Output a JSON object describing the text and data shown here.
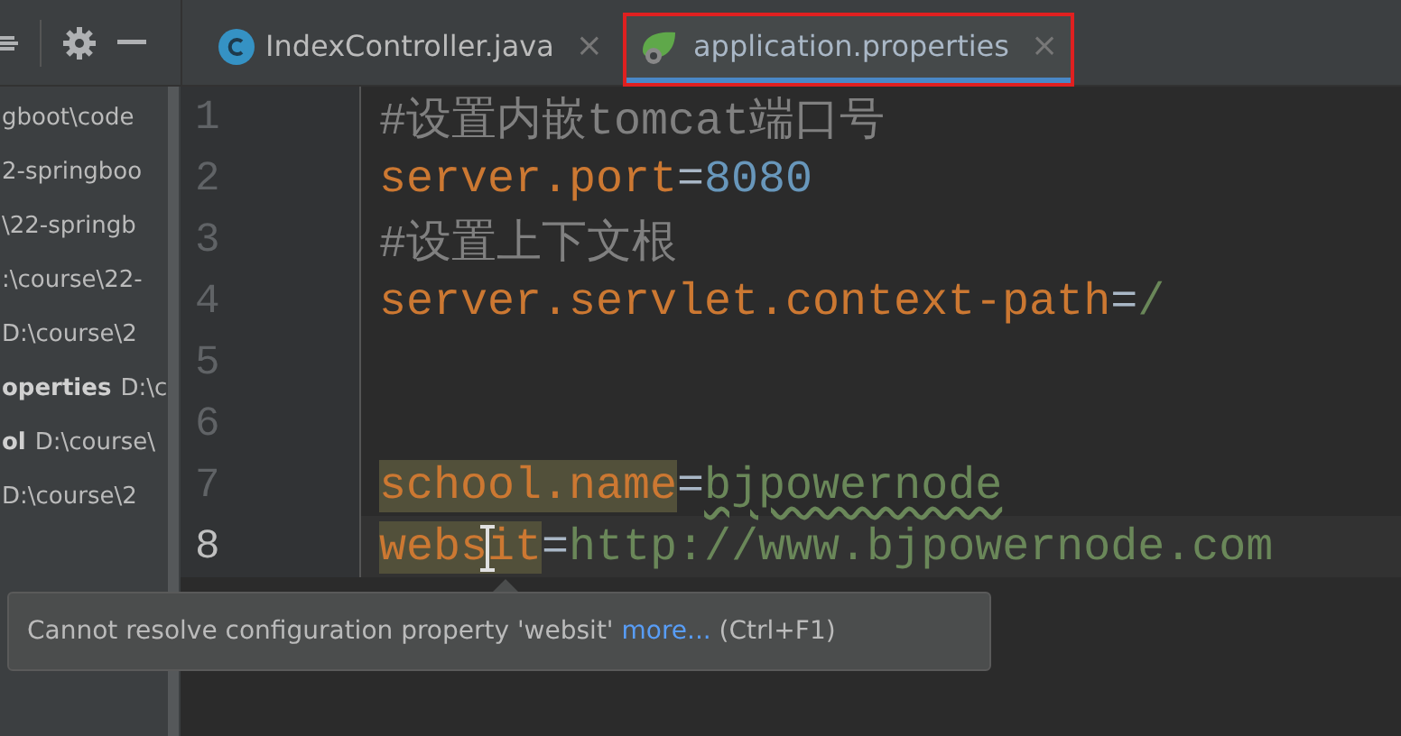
{
  "project_panel": {
    "items": [
      {
        "path": "gboot\\code"
      },
      {
        "path": "2-springboo"
      },
      {
        "path": "\\22-springb"
      },
      {
        "path": ":\\course\\22-"
      },
      {
        "path": "D:\\course\\2"
      },
      {
        "name": "operties",
        "path": "D:\\c"
      },
      {
        "name": "ol",
        "path": "D:\\course\\"
      },
      {
        "path": "D:\\course\\2"
      }
    ]
  },
  "tabs": [
    {
      "label": "IndexController.java",
      "kind": "java",
      "selected": false,
      "outlined": false,
      "close": "×"
    },
    {
      "label": "application.properties",
      "kind": "spring",
      "selected": true,
      "outlined": true,
      "close": "×"
    }
  ],
  "editor": {
    "lines": [
      {
        "number": "1",
        "current": false,
        "tokens": [
          {
            "kind": "comment",
            "text": "#设置内嵌tomcat端口号"
          }
        ]
      },
      {
        "number": "2",
        "current": false,
        "tokens": [
          {
            "kind": "key",
            "text": "server.port"
          },
          {
            "kind": "sep",
            "text": "="
          },
          {
            "kind": "number",
            "text": "8080"
          }
        ]
      },
      {
        "number": "3",
        "current": false,
        "tokens": [
          {
            "kind": "comment",
            "text": "#设置上下文根"
          }
        ]
      },
      {
        "number": "4",
        "current": false,
        "tokens": [
          {
            "kind": "key",
            "text": "server.servlet.context-path"
          },
          {
            "kind": "sep",
            "text": "="
          },
          {
            "kind": "value",
            "text": "/"
          }
        ]
      },
      {
        "number": "5",
        "current": false
      },
      {
        "number": "6",
        "current": false
      },
      {
        "number": "7",
        "current": false,
        "tokens": [
          {
            "kind": "key",
            "text": "school.name",
            "highlighted": true
          },
          {
            "kind": "sep",
            "text": "="
          },
          {
            "kind": "value",
            "text": "bjpowernode",
            "warning": true
          }
        ]
      },
      {
        "number": "8",
        "current": true,
        "tokens": [
          {
            "kind": "key",
            "text": "websit",
            "highlighted": true
          },
          {
            "kind": "sep",
            "text": "="
          },
          {
            "kind": "value",
            "text": "http://www.bjpowernode.com"
          }
        ]
      }
    ]
  },
  "tooltip": {
    "message": "Cannot resolve configuration property 'websit'",
    "link": "more...",
    "shortcut": "(Ctrl+F1)"
  }
}
